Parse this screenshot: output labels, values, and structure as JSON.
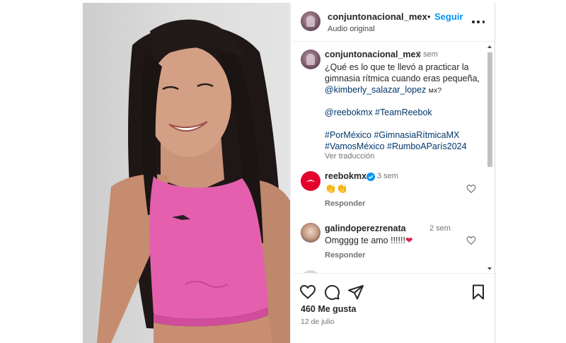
{
  "post": {
    "username": "conjuntonacional_mex",
    "separator": "•",
    "follow_label": "Seguir",
    "audio": "Audio original"
  },
  "caption": {
    "username": "conjuntonacional_mex",
    "time": "3 sem",
    "line1": "¿Qué es lo que te llevó a practicar la",
    "line2": "gimnasia rítmica cuando eras pequeña,",
    "mention": "@kimberly_salazar_lopez",
    "mention_suffix": "мх?",
    "tags1": "@reebokmx #TeamReebok",
    "tags2": "#PorMéxico #GimnasiaRítmicaMX",
    "tags3": "#VamosMéxico #RumboAParís2024",
    "translate": "Ver traducción"
  },
  "comments": [
    {
      "username": "reebokmx",
      "time": "3 sem",
      "text": "👏👏",
      "reply": "Responder",
      "verified": true,
      "avatar_color": "#e4002b"
    },
    {
      "username": "galindoperezrenata",
      "time": "2 sem",
      "text": "Omgggg te amo !!!!!!",
      "heart_emoji": "❤",
      "reply": "Responder",
      "verified": false
    }
  ],
  "footer": {
    "likes": "460 Me gusta",
    "date": "12 de julio"
  },
  "colors": {
    "link": "#0095f6",
    "mention": "#00376b",
    "verified": "#0095f6",
    "crop_top": "#e05aa6"
  },
  "icons": [
    "more-icon",
    "heart-icon",
    "comment-icon",
    "share-icon",
    "bookmark-icon",
    "verified-icon",
    "reebok-logo-icon"
  ]
}
